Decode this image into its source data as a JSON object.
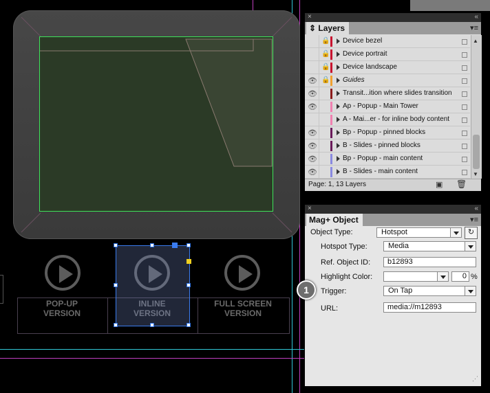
{
  "canvas": {
    "buttons": [
      {
        "label_line1": "POP-UP",
        "label_line2": "VERSION"
      },
      {
        "label_line1": "INLINE",
        "label_line2": "VERSION"
      },
      {
        "label_line1": "FULL SCREEN",
        "label_line2": "VERSION"
      }
    ]
  },
  "layers_panel": {
    "title": "Layers",
    "footer": "Page: 1, 13 Layers",
    "layers": [
      {
        "name": "Device bezel",
        "visible": false,
        "locked": true,
        "color": "#c8102e"
      },
      {
        "name": "Device portrait",
        "visible": false,
        "locked": true,
        "color": "#c8102e"
      },
      {
        "name": "Device landscape",
        "visible": false,
        "locked": true,
        "color": "#c8102e"
      },
      {
        "name": "Guides",
        "visible": true,
        "locked": true,
        "color": "#f0a030"
      },
      {
        "name": "Transit...ition where slides transition",
        "visible": true,
        "locked": false,
        "color": "#8b1a1a"
      },
      {
        "name": "Ap - Popup - Main Tower",
        "visible": true,
        "locked": false,
        "color": "#f080b0"
      },
      {
        "name": "A - Mai...er - for inline body content",
        "visible": false,
        "locked": false,
        "color": "#f080b0"
      },
      {
        "name": "Bp - Popup - pinned blocks",
        "visible": true,
        "locked": false,
        "color": "#6a1a5a"
      },
      {
        "name": "B - Slides - pinned blocks",
        "visible": true,
        "locked": false,
        "color": "#6a1a5a"
      },
      {
        "name": "Bp - Popup - main content",
        "visible": true,
        "locked": false,
        "color": "#8a8ae0"
      },
      {
        "name": "B - Slides - main content",
        "visible": true,
        "locked": false,
        "color": "#8a8ae0"
      }
    ]
  },
  "mag_panel": {
    "title": "Mag+ Object",
    "object_type_label": "Object Type:",
    "object_type_value": "Hotspot",
    "hotspot_type_label": "Hotspot Type:",
    "hotspot_type_value": "Media",
    "ref_label": "Ref. Object ID:",
    "ref_value": "b12893",
    "highlight_label": "Highlight Color:",
    "highlight_value": "",
    "highlight_percent": "0",
    "percent_sign": "%",
    "trigger_label": "Trigger:",
    "trigger_value": "On Tap",
    "url_label": "URL:",
    "url_value": "media://m12893",
    "callout": "1"
  }
}
